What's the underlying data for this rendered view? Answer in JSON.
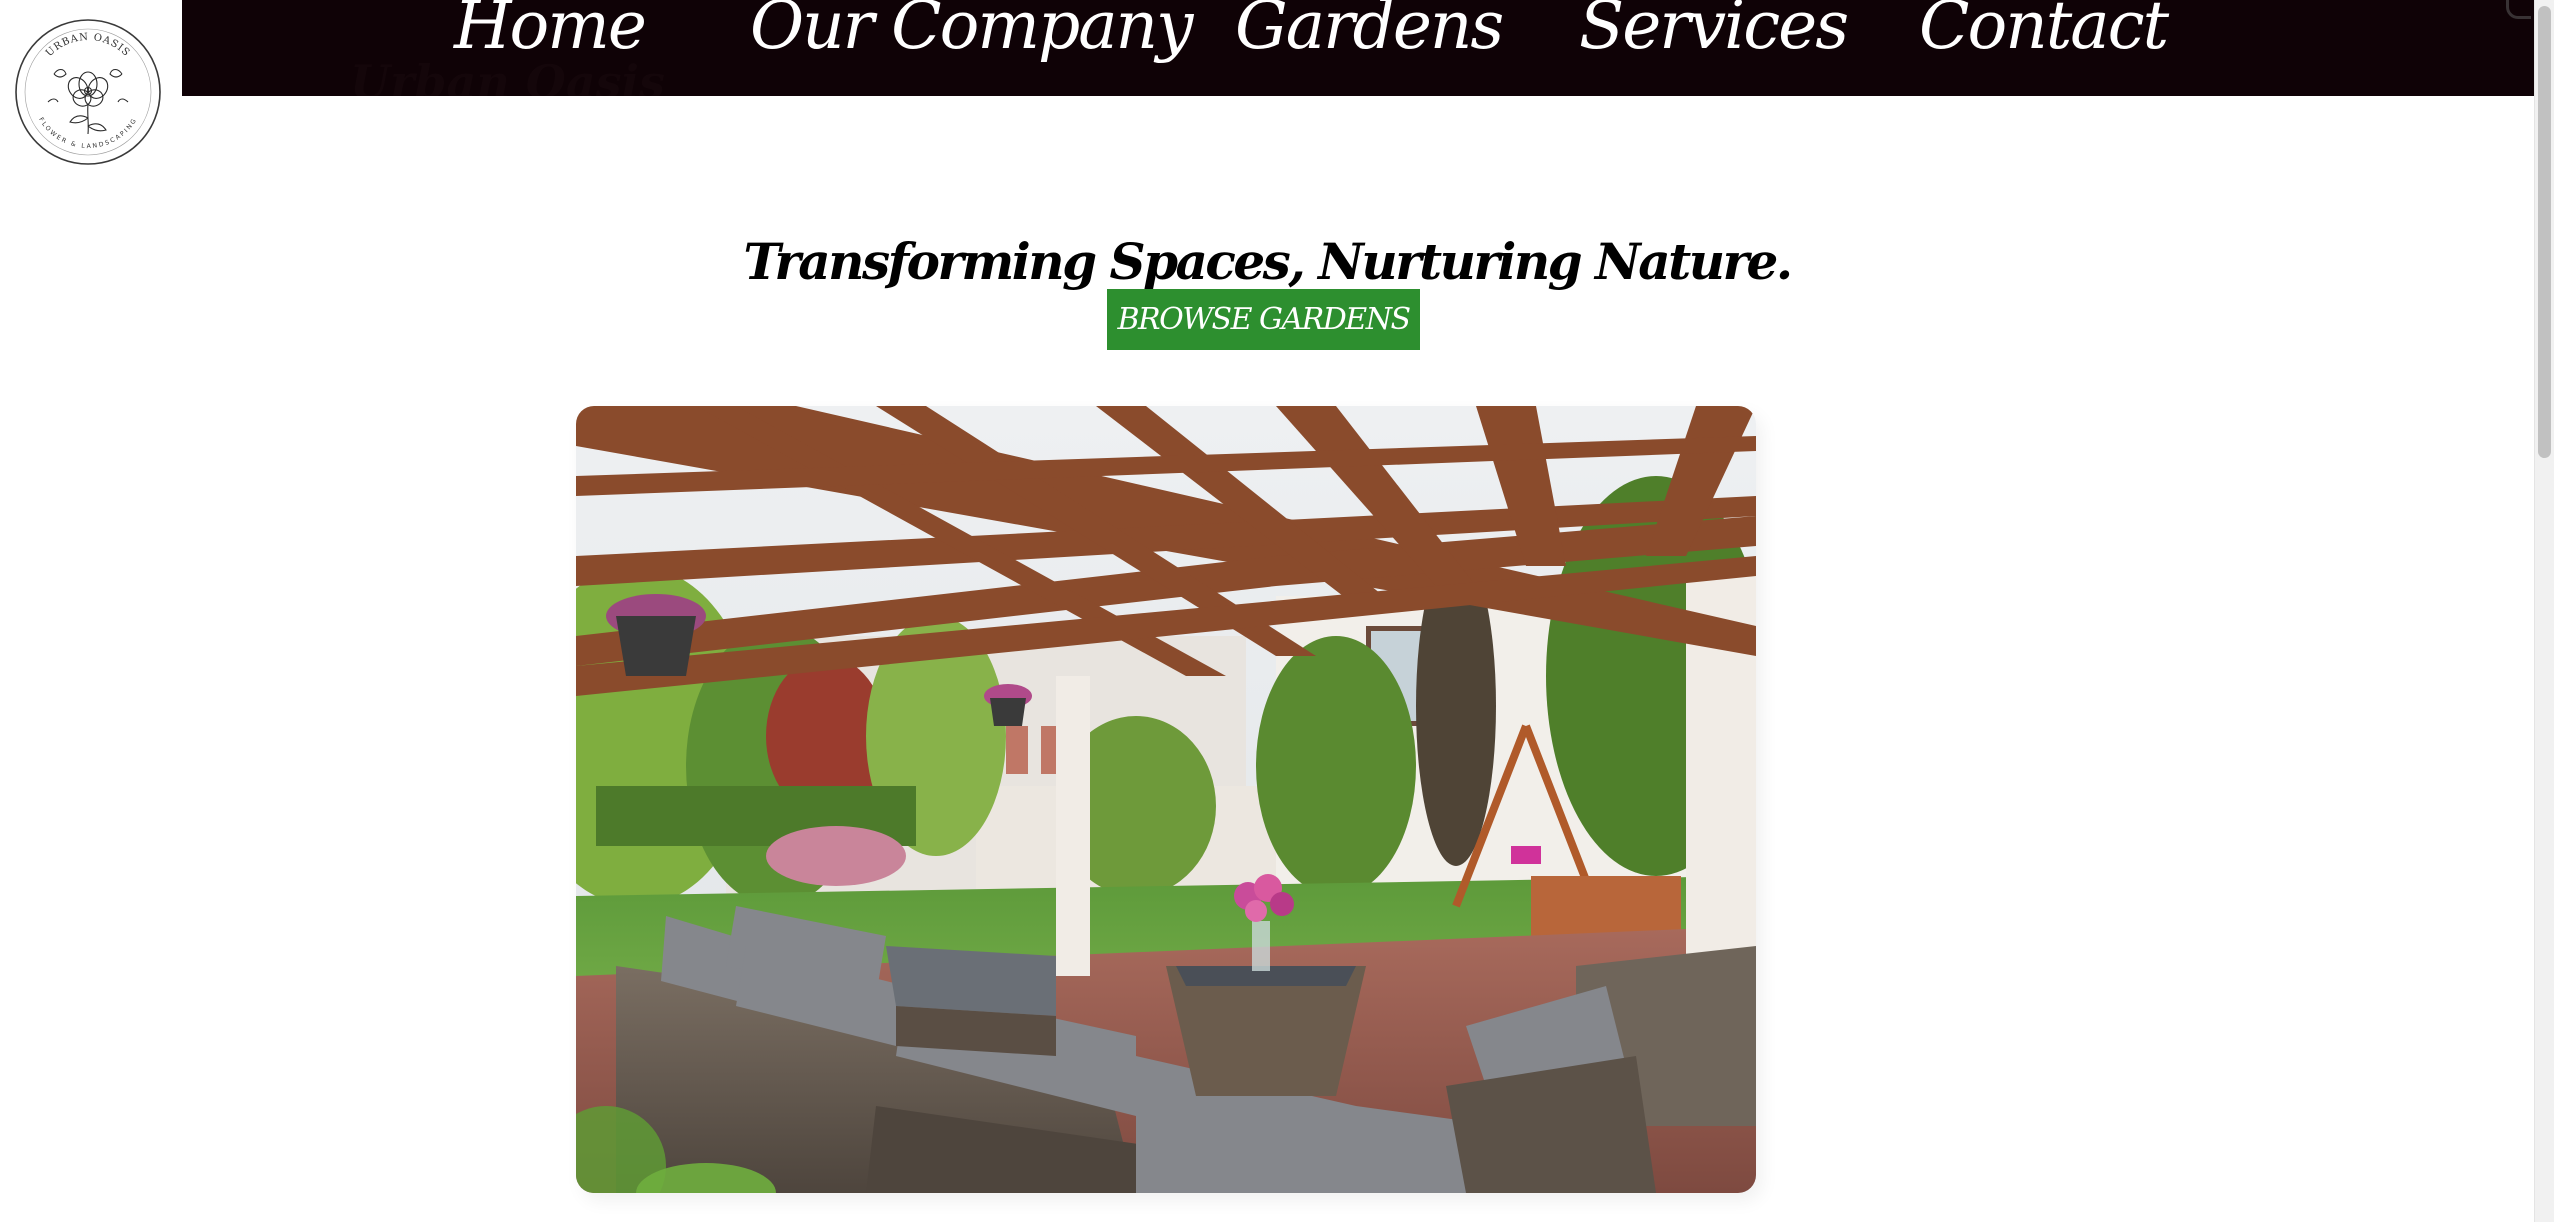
{
  "logo": {
    "icon": "flower-emblem",
    "arc_top": "URBAN OASIS",
    "arc_bottom": "FLOWER & LANDSCAPING"
  },
  "nav": {
    "items": [
      {
        "label": "Home"
      },
      {
        "label": "Our Company"
      },
      {
        "label": "Gardens"
      },
      {
        "label": "Services"
      },
      {
        "label": "Contact"
      }
    ],
    "background": "#0f0206",
    "text_color": "#ffffff"
  },
  "brand": {
    "overlap_text": "Urban Oasis"
  },
  "hero": {
    "tagline": "Transforming Spaces, Nurturing Nature.",
    "cta_label": "BROWSE GARDENS",
    "cta_color": "#2d8f2f",
    "image_subject": "covered-patio-pergola-with-wicker-sofa-and-garden"
  }
}
